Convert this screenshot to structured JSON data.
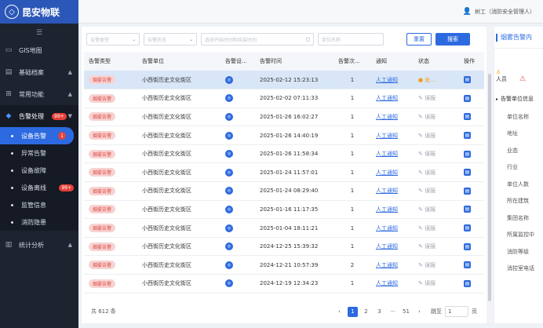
{
  "app": {
    "title": "昆安物联"
  },
  "header": {
    "user": "树工（消防安全管理人）"
  },
  "sidebar": {
    "items": [
      {
        "label": "GIS地图"
      },
      {
        "label": "基础档案"
      },
      {
        "label": "常用功能"
      },
      {
        "label": "告警处理",
        "badge": "99+"
      }
    ],
    "sub": [
      {
        "label": "设备告警",
        "badge": "1"
      },
      {
        "label": "异常告警"
      },
      {
        "label": "设备故障"
      },
      {
        "label": "设备离线",
        "badge": "99+"
      },
      {
        "label": "监管信息"
      },
      {
        "label": "消防隐患"
      }
    ],
    "stats": {
      "label": "统计分析"
    }
  },
  "filters": {
    "type_placeholder": "告警类型",
    "status_placeholder": "告警状态",
    "time_placeholder": "选择开始时间和结束时间",
    "unit_placeholder": "单位名称",
    "reset": "重置",
    "search": "搜索"
  },
  "table": {
    "headers": [
      "告警类型",
      "告警单位",
      "告警设...",
      "告警时间",
      "告警次...",
      "通知",
      "状态",
      "操作"
    ],
    "rows": [
      {
        "type": "烟雾告警",
        "unit": "小西街历史文化街区",
        "time": "2025-02-12 15:23:13",
        "count": "1",
        "notify": "人工通知",
        "status": "处..."
      },
      {
        "type": "烟雾告警",
        "unit": "小西街历史文化街区",
        "time": "2025-02-02 07:11:33",
        "count": "1",
        "notify": "人工通知",
        "status": "误报"
      },
      {
        "type": "烟雾告警",
        "unit": "小西街历史文化街区",
        "time": "2025-01-26 16:02:27",
        "count": "1",
        "notify": "人工通知",
        "status": "误报"
      },
      {
        "type": "烟雾告警",
        "unit": "小西街历史文化街区",
        "time": "2025-01-26 14:40:19",
        "count": "1",
        "notify": "人工通知",
        "status": "误报"
      },
      {
        "type": "烟雾告警",
        "unit": "小西街历史文化街区",
        "time": "2025-01-26 11:58:34",
        "count": "1",
        "notify": "人工通知",
        "status": "误报"
      },
      {
        "type": "烟雾告警",
        "unit": "小西街历史文化街区",
        "time": "2025-01-24 11:57:01",
        "count": "1",
        "notify": "人工通知",
        "status": "误报"
      },
      {
        "type": "烟雾告警",
        "unit": "小西街历史文化街区",
        "time": "2025-01-24 08:29:40",
        "count": "1",
        "notify": "人工通知",
        "status": "误报"
      },
      {
        "type": "烟雾告警",
        "unit": "小西街历史文化街区",
        "time": "2025-01-16 11:17:35",
        "count": "1",
        "notify": "人工通知",
        "status": "误报"
      },
      {
        "type": "烟雾告警",
        "unit": "小西街历史文化街区",
        "time": "2025-01-04 18:11:21",
        "count": "1",
        "notify": "人工通知",
        "status": "误报"
      },
      {
        "type": "烟雾告警",
        "unit": "小西街历史文化街区",
        "time": "2024-12-25 15:39:32",
        "count": "1",
        "notify": "人工通知",
        "status": "误报"
      },
      {
        "type": "烟雾告警",
        "unit": "小西街历史文化街区",
        "time": "2024-12-21 10:57:39",
        "count": "2",
        "notify": "人工通知",
        "status": "误报"
      },
      {
        "type": "烟雾告警",
        "unit": "小西街历史文化街区",
        "time": "2024-12-19 12:34:23",
        "count": "1",
        "notify": "人工通知",
        "status": "误报"
      }
    ]
  },
  "pagination": {
    "total": "共 612 条",
    "pages": [
      "1",
      "2",
      "3",
      "···",
      "51"
    ],
    "prev": "‹",
    "next": "›",
    "jump_label": "跳至",
    "jump_value": "1",
    "page_suffix": "页"
  },
  "right_panel": {
    "title": "烟雾告警内",
    "person_label": "人员",
    "section": "告警单位信息",
    "fields": [
      "单位名称",
      "地址",
      "业态",
      "行业",
      "单位人数",
      "所在建筑",
      "集团名称",
      "所属监控中",
      "消防等级",
      "消控室电话"
    ]
  },
  "colors": {
    "accent": "#2d6ae0",
    "sidebar": "#1e2330",
    "tag_bg": "#f6d3d2",
    "tag_fg": "#e24a44"
  }
}
